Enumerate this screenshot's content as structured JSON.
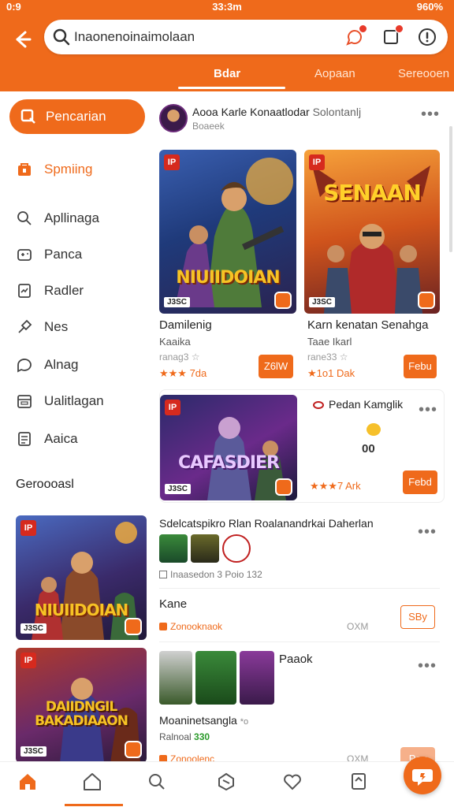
{
  "status": {
    "left": "0:9",
    "time": "33:3m",
    "right": "960%"
  },
  "search": {
    "value": "Inaonenoinaimolaan"
  },
  "tabs": [
    {
      "label": "Bdar",
      "active": true
    },
    {
      "label": "Aopaan"
    },
    {
      "label": "Sereooen"
    }
  ],
  "sidebar": {
    "cta": "Pencarian",
    "items": [
      {
        "label": "Spmiing",
        "icon": "shop-icon",
        "active": true
      },
      {
        "label": "Apllinaga",
        "icon": "search-icon"
      },
      {
        "label": "Panca",
        "icon": "gamepad-icon"
      },
      {
        "label": "Radler",
        "icon": "document-icon"
      },
      {
        "label": "Nes",
        "icon": "pin-icon"
      },
      {
        "label": "Alnag",
        "icon": "chat-icon"
      },
      {
        "label": "Ualitlagan",
        "icon": "calendar-icon"
      },
      {
        "label": "Aaica",
        "icon": "list-icon"
      }
    ],
    "section": "Geroooasl"
  },
  "feed_header": {
    "title": "Aooa Karle Konaatlodar",
    "title_extra": "Solontanlj",
    "subtitle": "Boaeek"
  },
  "cards": [
    {
      "headline": "NIUIIDOIAN",
      "label": "J3SC",
      "title": "Damilenig",
      "sub": "Kaaika",
      "meta": "ranag3 ☆",
      "rating": "★★★ 7da",
      "button": "Z6lW"
    },
    {
      "headline": "SENAAN",
      "label": "J3SC",
      "title": "Karn kenatan Senahga",
      "sub": "Taae Ikarl",
      "meta": "rane33 ☆",
      "rating": "★1o1 Dak",
      "button": "Febu"
    }
  ],
  "wide_card": {
    "headline": "CAFASDIER",
    "label": "J3SC",
    "title": "Pedan Kamglik",
    "value": "00",
    "rating": "★★★7 Ark",
    "button": "Febd"
  },
  "list_rows": [
    {
      "headline": "NIUIIDOIAN",
      "label": "J3SC",
      "title": "Sdelcatspikro Rlan Roalanandrkai Daherlan",
      "meta": "Inaasedon 3 Poio 132"
    },
    {
      "title": "Kane",
      "meta": "Zonooknaok",
      "extra": "OXM",
      "button": "SBy"
    },
    {
      "headline": "DAIIDNGIL BAKADIAAON",
      "label": "J3SC",
      "title": "Paaok",
      "sub": "Moaninetsangla",
      "sub_extra": "*o",
      "meta": "Ralnoal",
      "meta_extra": "330",
      "meta2": "Zonoolenc",
      "extra": "OXM",
      "button": "Pev"
    }
  ],
  "colors": {
    "accent": "#ef6a1b",
    "background": "#ffffff"
  }
}
